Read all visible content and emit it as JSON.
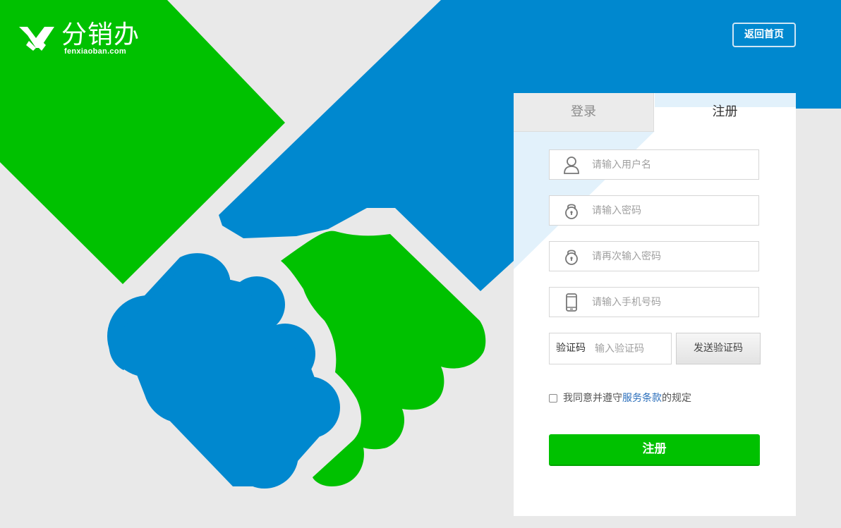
{
  "brand": {
    "name": "分销办",
    "domain": "fenxiaoban.com",
    "logo_icon": "handshake-logo-icon"
  },
  "header": {
    "home_button": "返回首页"
  },
  "tabs": {
    "login": "登录",
    "register": "注册",
    "active": "register"
  },
  "form": {
    "username": {
      "placeholder": "请输入用户名",
      "icon": "user-icon"
    },
    "password": {
      "placeholder": "请输入密码",
      "icon": "lock-icon"
    },
    "password_confirm": {
      "placeholder": "请再次输入密码",
      "icon": "lock-icon"
    },
    "phone": {
      "placeholder": "请输入手机号码",
      "icon": "phone-icon"
    },
    "verify": {
      "label": "验证码",
      "placeholder": "输入验证码",
      "send_button": "发送验证码"
    },
    "agreement": {
      "prefix": "我同意并遵守",
      "link": "服务条款",
      "suffix": "的规定",
      "checked": false
    },
    "submit": "注册"
  },
  "colors": {
    "brand_green": "#00c100",
    "brand_blue": "#0088cf",
    "background": "#e9e9e9",
    "link": "#2a6ebb"
  }
}
